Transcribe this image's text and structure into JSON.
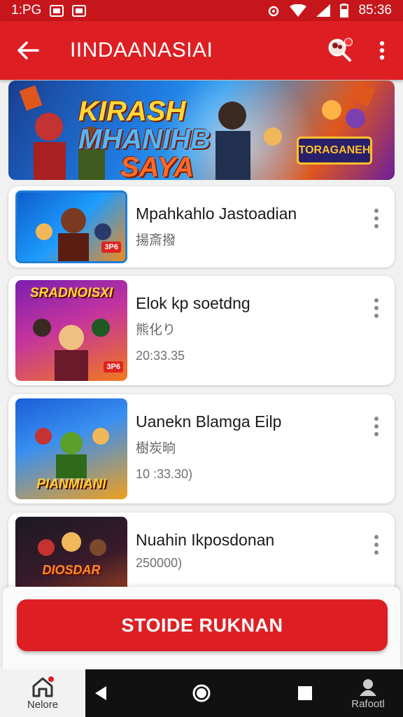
{
  "status_bar": {
    "time_left": "1:PG",
    "time_right": "85:36"
  },
  "app_bar": {
    "title": "IINDAANASIAI",
    "back_icon": "arrow-left-icon",
    "search_icon": "search-icon",
    "more_icon": "more-vertical-icon"
  },
  "banner": {
    "title_line1": "KIRASH",
    "title_line2": "MHANIHB",
    "title_line3": "SAYA",
    "badge": "TORAGANEH"
  },
  "cards": [
    {
      "title": "Mpahkahlo Jastoadian",
      "subtitle": "揚斎撥",
      "time": "",
      "thumb_label": "",
      "tag": "3P6"
    },
    {
      "title": "Elok  kp soetdng",
      "subtitle": "熊化り",
      "time": "20:33.35",
      "thumb_label": "SRADNOISXI",
      "tag": "3P6"
    },
    {
      "title": "Uanekn Blamga Eilp",
      "subtitle": "樹炭晌",
      "time": "10 :33.30)",
      "thumb_label": "PIANMIANI",
      "tag": ""
    },
    {
      "title": "Nuahin Ikposdonan",
      "subtitle": "",
      "time": "250000)",
      "thumb_label": "DIOSDAR",
      "tag": ""
    }
  ],
  "cta": {
    "label": "STOIDE RUKNAN"
  },
  "bottom_nav": {
    "home_label": "Nelore",
    "right_label": "Rafootl"
  },
  "colors": {
    "primary": "#dd1f24",
    "status": "#c6161b"
  }
}
